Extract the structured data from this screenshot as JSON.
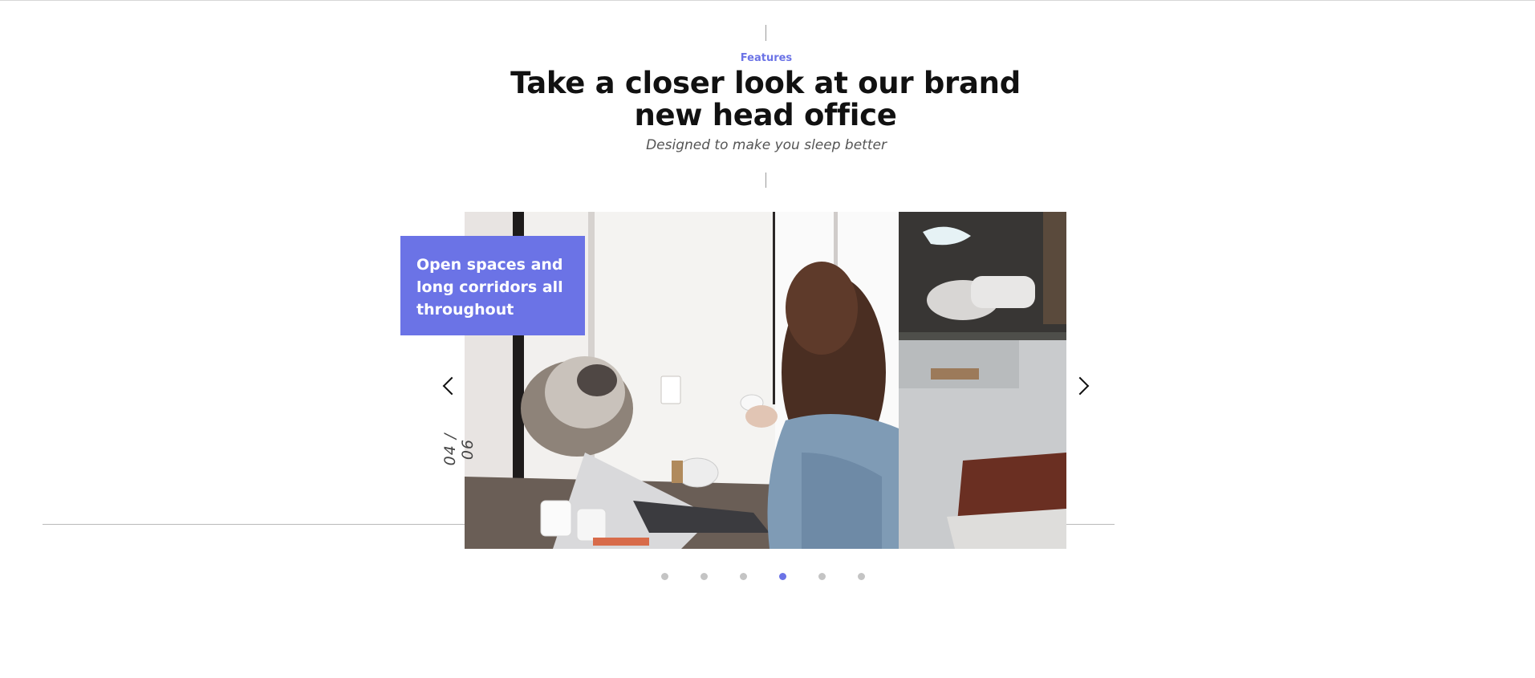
{
  "section": {
    "eyebrow": "Features",
    "title": "Take a closer look at our brand new head office",
    "subtitle": "Designed to make you sleep better"
  },
  "slider": {
    "caption": "Open spaces and long corridors all throughout",
    "counter": "04 / 06",
    "current": 4,
    "total": 6,
    "prev_icon": "chevron-left-icon",
    "next_icon": "chevron-right-icon",
    "dots": [
      {
        "active": false
      },
      {
        "active": false
      },
      {
        "active": false
      },
      {
        "active": true
      },
      {
        "active": false
      },
      {
        "active": false
      }
    ]
  },
  "colors": {
    "accent": "#6b73e6",
    "heading": "#111111",
    "text_muted": "#555555",
    "dot_inactive": "#c4c4c4"
  }
}
